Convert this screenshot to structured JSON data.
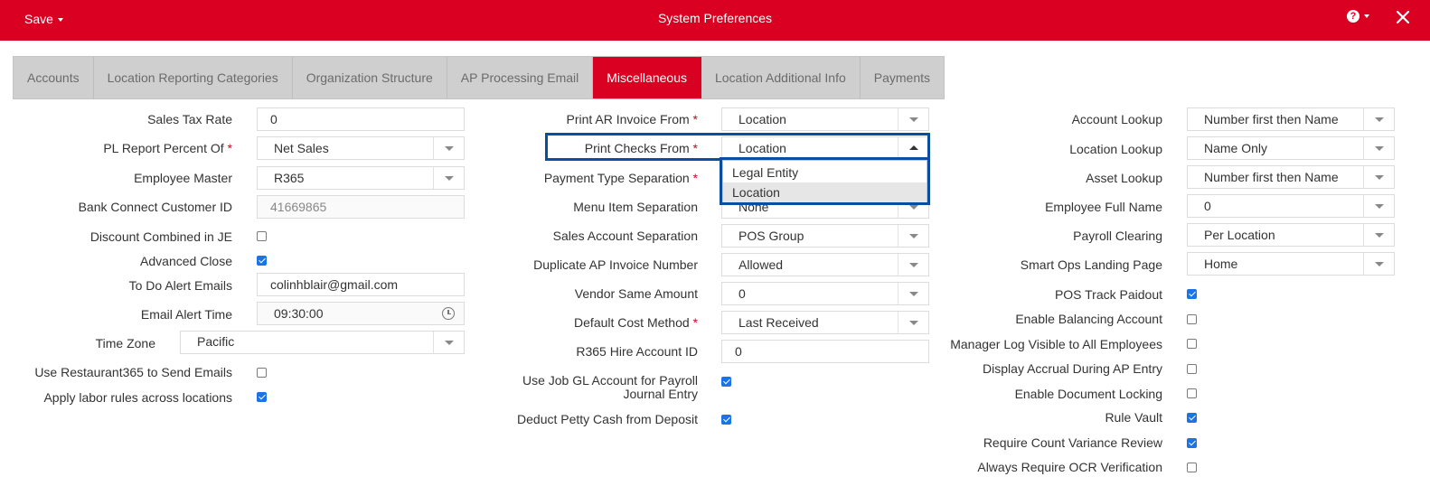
{
  "header": {
    "save_label": "Save",
    "title": "System Preferences",
    "help_icon": "question-circle-icon",
    "close_icon": "close-icon"
  },
  "tabs": [
    "Accounts",
    "Location Reporting Categories",
    "Organization Structure",
    "AP Processing Email",
    "Miscellaneous",
    "Location Additional Info",
    "Payments"
  ],
  "active_tab": "Miscellaneous",
  "colors": {
    "brand": "#d90021",
    "focus": "#0a4da1",
    "checkbox": "#1a73e8"
  },
  "left": {
    "sales_tax_rate": {
      "label": "Sales Tax Rate",
      "value": "0"
    },
    "pl_report_percent_of": {
      "label": "PL Report Percent Of",
      "required": "*",
      "value": "Net Sales"
    },
    "employee_master": {
      "label": "Employee Master",
      "value": "R365"
    },
    "bank_connect_customer_id": {
      "label": "Bank Connect Customer ID",
      "value": "41669865"
    },
    "discount_combined_in_je": {
      "label": "Discount Combined in JE",
      "checked": false
    },
    "advanced_close": {
      "label": "Advanced Close",
      "checked": true
    },
    "to_do_alert_emails": {
      "label": "To Do Alert Emails",
      "value": "colinhblair@gmail.com"
    },
    "email_alert_time": {
      "label": "Email Alert Time",
      "value": "09:30:00",
      "icon": "clock-icon"
    },
    "time_zone": {
      "label": "Time Zone",
      "value": "Pacific"
    },
    "use_r365_send_emails": {
      "label": "Use Restaurant365 to Send Emails",
      "checked": false
    },
    "apply_labor_rules": {
      "label": "Apply labor rules across locations",
      "checked": true
    }
  },
  "middle": {
    "print_ar_invoice_from": {
      "label": "Print AR Invoice From",
      "required": "*",
      "value": "Location"
    },
    "print_checks_from": {
      "label": "Print Checks From",
      "required": "*",
      "value": "Location",
      "options": [
        "Legal Entity",
        "Location"
      ]
    },
    "payment_type_separation": {
      "label": "Payment Type Separation",
      "required": "*"
    },
    "menu_item_separation": {
      "label": "Menu Item Separation",
      "value": "None"
    },
    "sales_account_separation": {
      "label": "Sales Account Separation",
      "value": "POS Group"
    },
    "duplicate_ap_invoice_number": {
      "label": "Duplicate AP Invoice Number",
      "value": "Allowed"
    },
    "vendor_same_amount": {
      "label": "Vendor Same Amount",
      "value": "0"
    },
    "default_cost_method": {
      "label": "Default Cost Method",
      "required": "*",
      "value": "Last Received"
    },
    "r365_hire_account_id": {
      "label": "R365 Hire Account ID",
      "value": "0"
    },
    "use_job_gl_account": {
      "label_line1": "Use Job GL Account for Payroll",
      "label_line2": "Journal Entry",
      "checked": true
    },
    "deduct_petty_cash": {
      "label": "Deduct Petty Cash from Deposit",
      "checked": true
    }
  },
  "right": {
    "account_lookup": {
      "label": "Account Lookup",
      "value": "Number first then Name"
    },
    "location_lookup": {
      "label": "Location Lookup",
      "value": "Name Only"
    },
    "asset_lookup": {
      "label": "Asset Lookup",
      "value": "Number first then Name"
    },
    "employee_full_name": {
      "label": "Employee Full Name",
      "value": "0"
    },
    "payroll_clearing": {
      "label": "Payroll Clearing",
      "value": "Per Location"
    },
    "smart_ops_landing_page": {
      "label": "Smart Ops Landing Page",
      "value": "Home"
    },
    "pos_track_paidout": {
      "label": "POS Track Paidout",
      "checked": true
    },
    "enable_balancing_account": {
      "label": "Enable Balancing Account",
      "checked": false
    },
    "manager_log_visible": {
      "label": "Manager Log Visible to All Employees",
      "checked": false
    },
    "display_accrual": {
      "label": "Display Accrual During AP Entry",
      "checked": false
    },
    "enable_document_locking": {
      "label": "Enable Document Locking",
      "checked": false
    },
    "rule_vault": {
      "label": "Rule Vault",
      "checked": true
    },
    "require_count_variance_review": {
      "label": "Require Count Variance Review",
      "checked": true
    },
    "always_require_ocr": {
      "label": "Always Require OCR Verification",
      "checked": false
    }
  }
}
